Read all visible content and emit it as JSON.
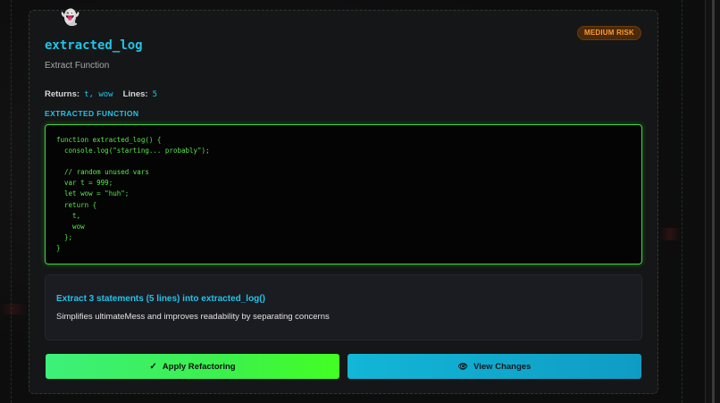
{
  "card": {
    "ghost_icon": "👻",
    "risk_badge": "MEDIUM RISK",
    "title": "extracted_log",
    "subtitle": "Extract Function",
    "returns_label": "Returns:",
    "returns_value": "t, wow",
    "lines_label": "Lines:",
    "lines_value": "5",
    "section_label": "EXTRACTED FUNCTION",
    "code": "function extracted_log() {\n  console.log(\"starting... probably\");\n\n  // random unused vars\n  var t = 999;\n  let wow = \"huh\";\n  return {\n    t,\n    wow\n  };\n}",
    "description_title": "Extract 3 statements (5 lines) into extracted_log()",
    "description_text": "Simplifies ultimateMess and improves readability by separating concerns",
    "apply_button": {
      "icon": "✓",
      "label": "Apply Refactoring"
    },
    "view_button": {
      "icon": "👁",
      "label": "View Changes"
    }
  },
  "colors": {
    "accent_cyan": "#22c3e6",
    "code_green": "#57e84a",
    "risk_orange": "#ff9a2e"
  }
}
